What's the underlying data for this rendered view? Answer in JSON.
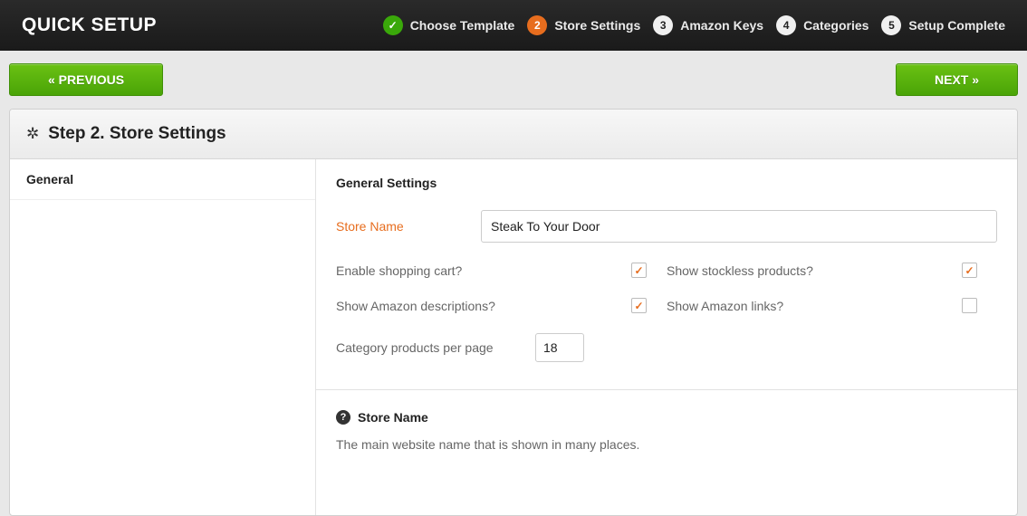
{
  "header": {
    "title": "QUICK SETUP",
    "steps": [
      {
        "label": "Choose Template",
        "state": "done",
        "badge": "✓"
      },
      {
        "label": "Store Settings",
        "state": "current",
        "badge": "2"
      },
      {
        "label": "Amazon Keys",
        "state": "pending",
        "badge": "3"
      },
      {
        "label": "Categories",
        "state": "pending",
        "badge": "4"
      },
      {
        "label": "Setup Complete",
        "state": "pending",
        "badge": "5"
      }
    ]
  },
  "nav": {
    "prev": "« PREVIOUS",
    "next": "NEXT »"
  },
  "panel": {
    "title": "Step 2. Store Settings",
    "sidebar": {
      "items": [
        {
          "label": "General"
        }
      ]
    }
  },
  "form": {
    "section_title": "General Settings",
    "store_name_label": "Store Name",
    "store_name_value": "Steak To Your Door",
    "enable_cart_label": "Enable shopping cart?",
    "enable_cart_checked": true,
    "show_stockless_label": "Show stockless products?",
    "show_stockless_checked": true,
    "show_amazon_desc_label": "Show Amazon descriptions?",
    "show_amazon_desc_checked": true,
    "show_amazon_links_label": "Show Amazon links?",
    "show_amazon_links_checked": false,
    "per_page_label": "Category products per page",
    "per_page_value": "18"
  },
  "help": {
    "title": "Store Name",
    "text": "The main website name that is shown in many places."
  }
}
